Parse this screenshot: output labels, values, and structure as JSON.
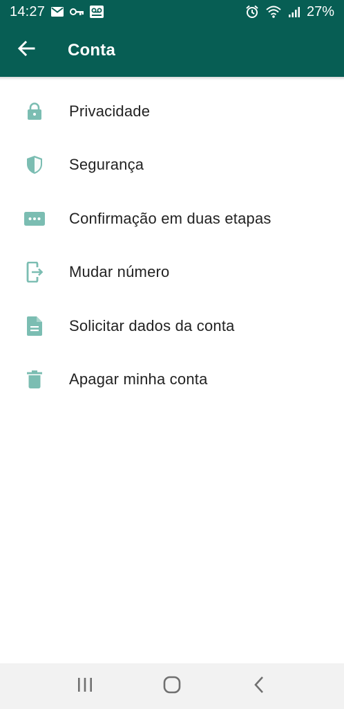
{
  "status_bar": {
    "time": "14:27",
    "battery": "27%",
    "left_icons": [
      "mail-icon",
      "key-icon",
      "voicemail-icon"
    ],
    "right_icons": [
      "alarm-icon",
      "wifi-icon",
      "signal-icon"
    ]
  },
  "app_bar": {
    "title": "Conta",
    "back_icon": "arrow-left-icon",
    "background": "#075e54"
  },
  "menu": {
    "icon_color": "#7bbdb2",
    "items": [
      {
        "label": "Privacidade",
        "icon": "lock-icon"
      },
      {
        "label": "Segurança",
        "icon": "shield-icon"
      },
      {
        "label": "Confirmação em duas etapas",
        "icon": "dots-box-icon"
      },
      {
        "label": "Mudar número",
        "icon": "phone-change-icon"
      },
      {
        "label": "Solicitar dados da conta",
        "icon": "document-icon"
      },
      {
        "label": "Apagar minha conta",
        "icon": "trash-icon"
      }
    ]
  },
  "nav_bar": {
    "buttons": [
      "recents-icon",
      "home-icon",
      "back-icon"
    ]
  }
}
